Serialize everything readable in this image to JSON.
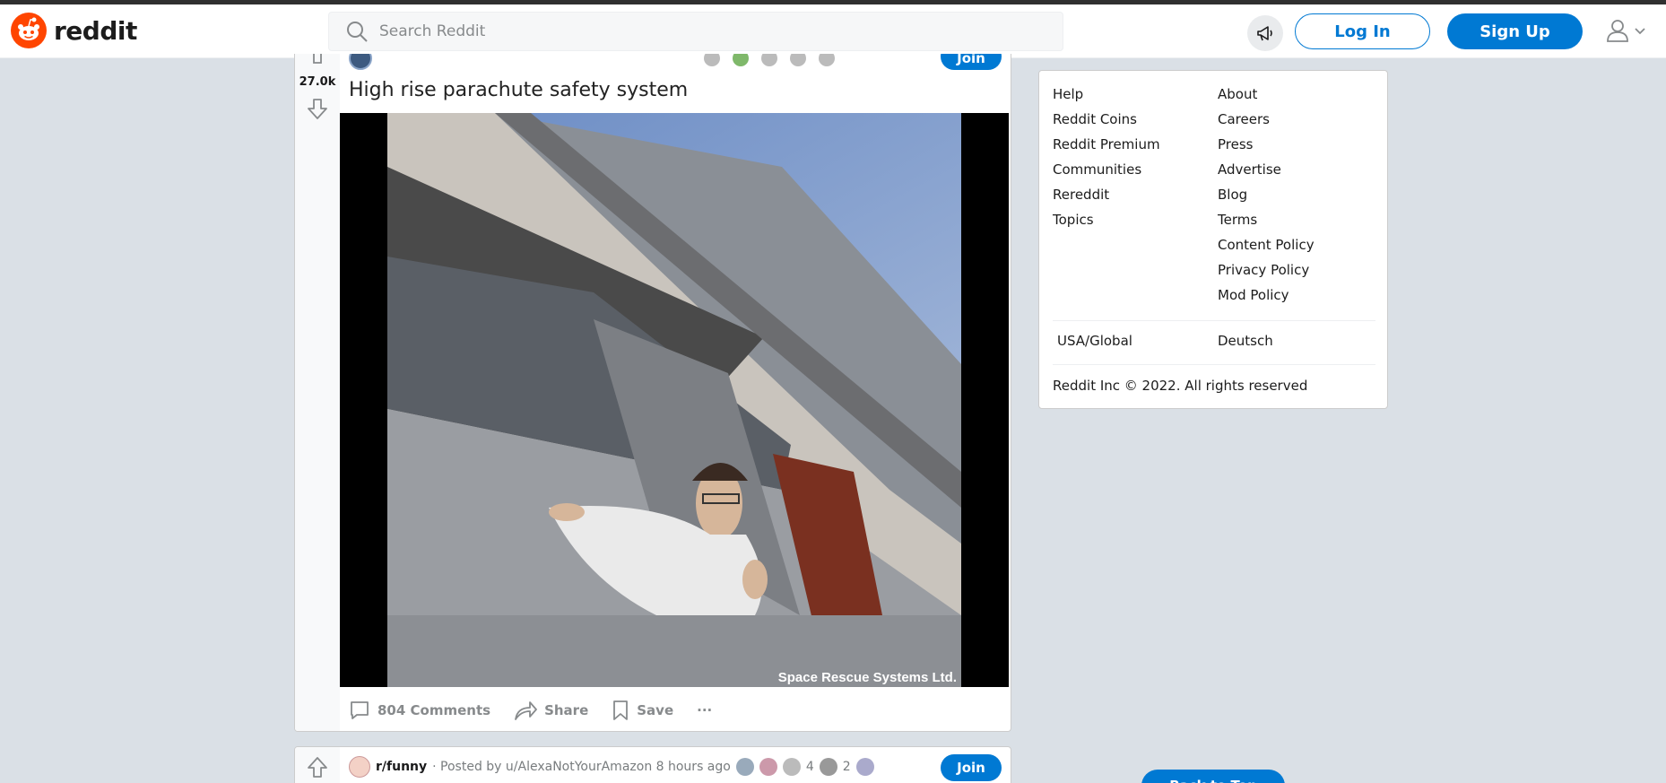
{
  "header": {
    "logo_text": "reddit",
    "search_placeholder": "Search Reddit",
    "login_label": "Log In",
    "signup_label": "Sign Up"
  },
  "post": {
    "score": "27.0k",
    "title": "High rise parachute safety system",
    "join_label": "Join",
    "video_watermark": "Space Rescue Systems Ltd.",
    "actions": {
      "comments": "804 Comments",
      "share": "Share",
      "save": "Save",
      "more": "···"
    }
  },
  "next_post": {
    "subreddit": "r/funny",
    "posted_by": "· Posted by u/AlexaNotYourAmazon 8 hours ago",
    "award_count_a": "4",
    "award_count_b": "2",
    "join_label": "Join"
  },
  "sidebar": {
    "links_left": [
      "Help",
      "Reddit Coins",
      "Reddit Premium",
      "Communities",
      "Rereddit",
      "Topics"
    ],
    "links_right": [
      "About",
      "Careers",
      "Press",
      "Advertise",
      "Blog",
      "Terms",
      "Content Policy",
      "Privacy Policy",
      "Mod Policy"
    ],
    "lang_1": "USA/Global",
    "lang_2": "Deutsch",
    "copyright": "Reddit Inc © 2022. All rights reserved"
  },
  "back_to_top": "Back to Top",
  "colors": {
    "accent": "#0079d3",
    "brand": "#ff4500",
    "page_bg": "#dae0e6"
  }
}
